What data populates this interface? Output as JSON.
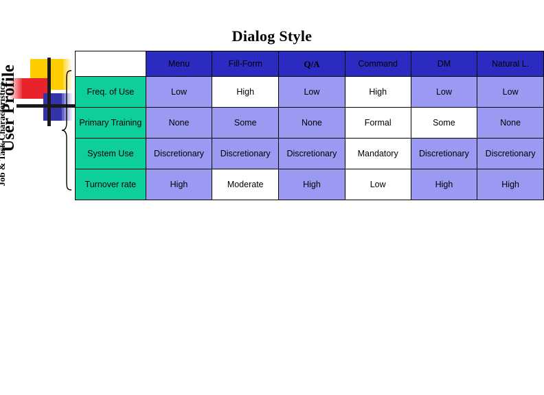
{
  "slide": {
    "title": "Dialog Style",
    "left_axis_label": "User Profile",
    "left_sub_label": "Job & Task Characteristics",
    "decoration": {
      "name": "powerpoint-color-blocks",
      "yellow": "#FFCC00",
      "red": "#E8232B",
      "blue": "#3333AA",
      "bar": "#1A1A1A"
    },
    "brace": "{"
  },
  "colors": {
    "header_blue": "#2B2BC2",
    "body_blue": "#9A9AF2",
    "row_header_green": "#0ECF9C",
    "highlight_white": "#FFFFFF",
    "border": "#000000",
    "text": "#000000"
  },
  "matrix": {
    "corner_label": "",
    "column_headers": [
      "Menu",
      "Fill-Form",
      "Q/A",
      "Command",
      "DM",
      "Natural L."
    ],
    "row_headers": [
      "Freq. of Use",
      "Primary Training",
      "System Use",
      "Turnover rate"
    ],
    "rows": [
      {
        "header": "Freq. of Use",
        "cells": [
          {
            "value": "Low",
            "highlight": false
          },
          {
            "value": "High",
            "highlight": true
          },
          {
            "value": "Low",
            "highlight": false
          },
          {
            "value": "High",
            "highlight": true
          },
          {
            "value": "Low",
            "highlight": false
          },
          {
            "value": "Low",
            "highlight": false
          }
        ]
      },
      {
        "header": "Primary Training",
        "cells": [
          {
            "value": "None",
            "highlight": false
          },
          {
            "value": "Some",
            "highlight": false
          },
          {
            "value": "None",
            "highlight": false
          },
          {
            "value": "Formal",
            "highlight": true
          },
          {
            "value": "Some",
            "highlight": true
          },
          {
            "value": "None",
            "highlight": false
          }
        ]
      },
      {
        "header": "System Use",
        "cells": [
          {
            "value": "Discretionary",
            "highlight": false
          },
          {
            "value": "Discretionary",
            "highlight": false
          },
          {
            "value": "Discretionary",
            "highlight": false
          },
          {
            "value": "Mandatory",
            "highlight": true
          },
          {
            "value": "Discretionary",
            "highlight": false
          },
          {
            "value": "Discretionary",
            "highlight": false
          }
        ]
      },
      {
        "header": "Turnover rate",
        "cells": [
          {
            "value": "High",
            "highlight": false
          },
          {
            "value": "Moderate",
            "highlight": true
          },
          {
            "value": "High",
            "highlight": false
          },
          {
            "value": "Low",
            "highlight": true
          },
          {
            "value": "High",
            "highlight": false
          },
          {
            "value": "High",
            "highlight": false
          }
        ]
      }
    ]
  }
}
